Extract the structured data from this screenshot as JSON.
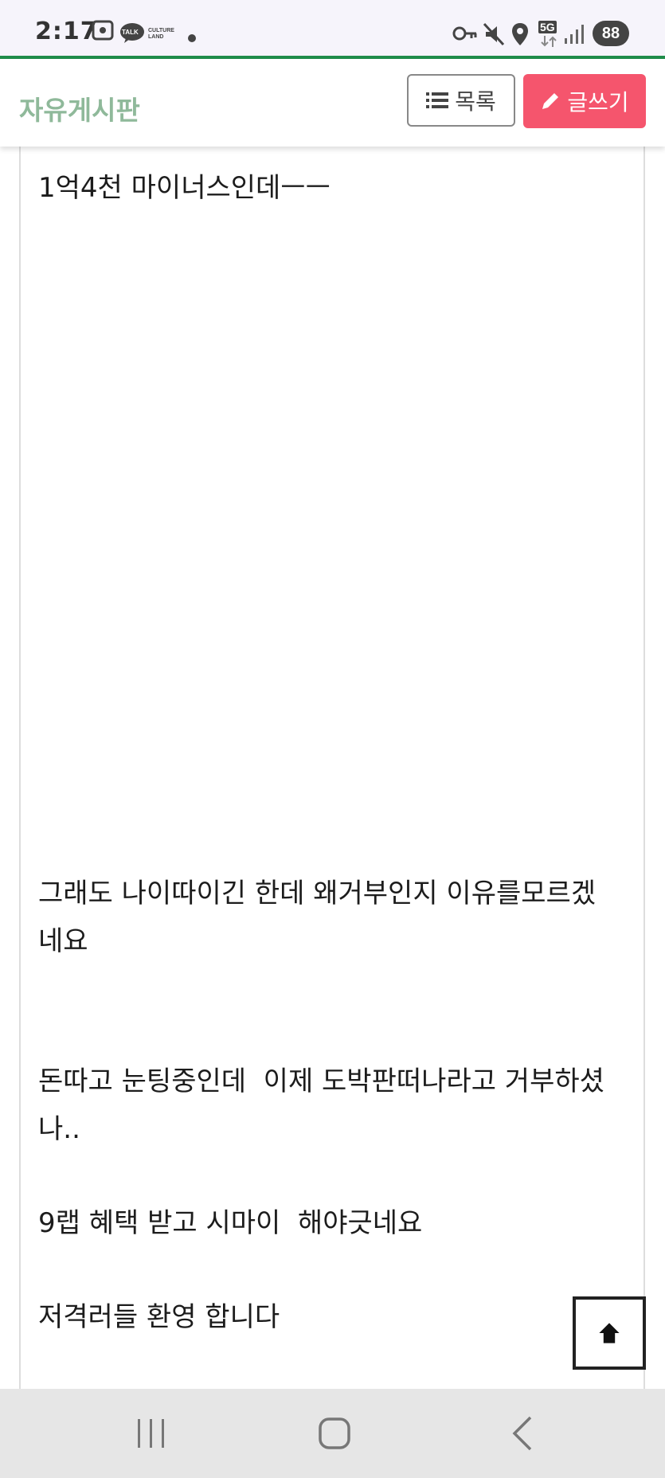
{
  "status_bar": {
    "time": "2:17",
    "talk_badge": "TALK",
    "culture_land": "CULTURE LAND",
    "network": "5G",
    "battery": "88"
  },
  "header": {
    "title": "자유게시판",
    "list_button": "목록",
    "write_button": "글쓰기"
  },
  "post": {
    "lines": [
      "1억4천 마이너스인데ㅡㅡ",
      "그래도 나이따이긴 한데 왜거부인지 이유를모르겠",
      "네요",
      "돈따고 눈팅중인데  이제 도박판떠나라고 거부하셨",
      "나..",
      "9랩 혜택 받고 시마이  해야긋네요",
      "저격러들 환영 합니다"
    ]
  },
  "nav": {
    "recent": "recent-apps-icon",
    "home": "home-icon",
    "back": "back-icon"
  }
}
